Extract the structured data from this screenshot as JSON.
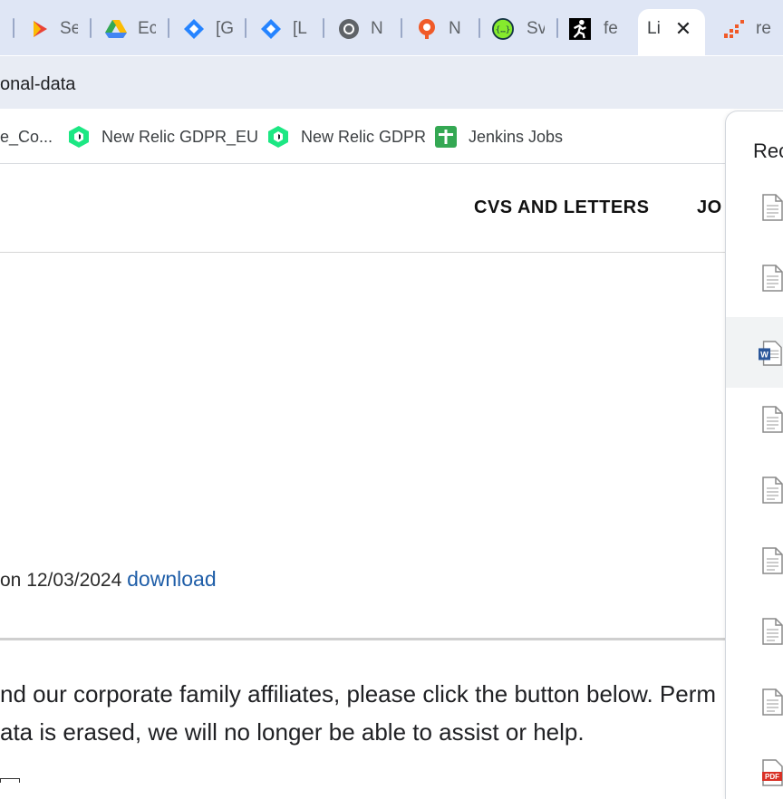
{
  "tabs": [
    {
      "title": "Se",
      "icon": "play-store-icon"
    },
    {
      "title": "Ec",
      "icon": "google-drive-icon"
    },
    {
      "title": "[G",
      "icon": "jira-icon"
    },
    {
      "title": "[L",
      "icon": "jira-icon"
    },
    {
      "title": "N",
      "icon": "chrome-icon"
    },
    {
      "title": "N",
      "icon": "grafana-icon"
    },
    {
      "title": "Sv",
      "icon": "swagger-icon"
    },
    {
      "title": "fe",
      "icon": "runner-icon"
    },
    {
      "title": "Li",
      "icon": "page-icon",
      "active": true
    },
    {
      "title": "re",
      "icon": "bars-icon"
    }
  ],
  "address_bar": {
    "url": "onal-data"
  },
  "bookmarks": [
    {
      "label": "e_Co...",
      "icon": "none"
    },
    {
      "label": "New Relic GDPR_EU",
      "icon": "new-relic-icon"
    },
    {
      "label": "New Relic GDPR",
      "icon": "new-relic-icon"
    },
    {
      "label": "Jenkins Jobs",
      "icon": "google-sheets-icon"
    }
  ],
  "page": {
    "nav": [
      "CVS AND LETTERS",
      "JO"
    ],
    "date_text": "on 12/03/2024 ",
    "download_label": "download",
    "paragraph_line1": "nd our corporate family affiliates, please click the button below. Perm",
    "paragraph_line2": "ata is erased, we will no longer be able to assist or help."
  },
  "side_panel": {
    "title": "Rec",
    "items": [
      {
        "type": "document"
      },
      {
        "type": "document"
      },
      {
        "type": "word",
        "selected": true
      },
      {
        "type": "document"
      },
      {
        "type": "document"
      },
      {
        "type": "document"
      },
      {
        "type": "document"
      },
      {
        "type": "document"
      },
      {
        "type": "pdf",
        "badge": "PDF"
      }
    ]
  },
  "colors": {
    "tabstrip_bg": "#dfe6f5",
    "link_blue": "#1f5ea8",
    "new_relic_green": "#1ce783",
    "jenkins_green": "#34a853"
  }
}
